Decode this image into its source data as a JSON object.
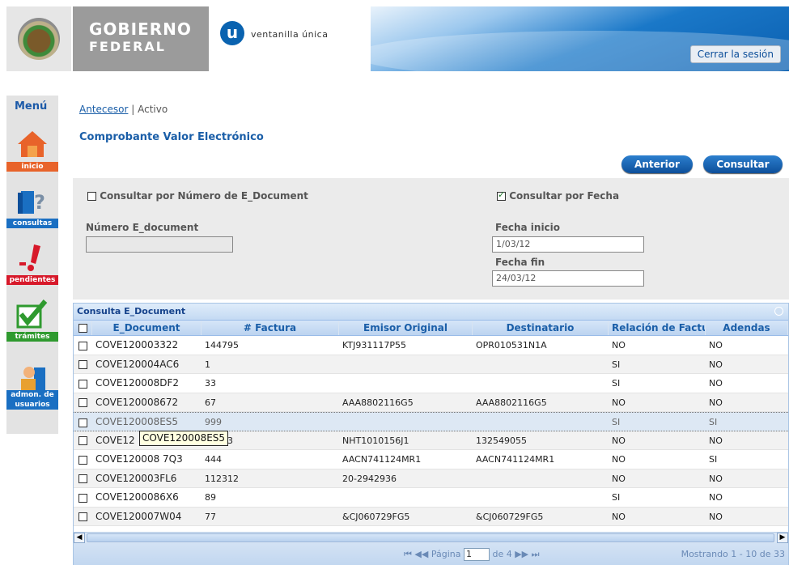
{
  "header": {
    "gov_title": "GOBIERNO",
    "gov_subtitle": "FEDERAL",
    "vu_letter": "u",
    "vu_text": "ventanilla única",
    "logout_label": "Cerrar la sesión"
  },
  "menu": {
    "title": "Menú",
    "items": [
      {
        "label": "inicio",
        "icon": "house-icon",
        "color": "#e8632a"
      },
      {
        "label": "consultas",
        "icon": "book-question-icon",
        "color": "#1a6fc2"
      },
      {
        "label": "pendientes",
        "icon": "exclamation-icon",
        "color": "#d7192a"
      },
      {
        "label": "trámites",
        "icon": "checkmark-icon",
        "color": "#2f9a2f"
      },
      {
        "label": "admon. de usuarios",
        "icon": "users-icon",
        "color": "#1a6fc2"
      }
    ]
  },
  "breadcrumb": {
    "link": "Antecesor",
    "separator": "|",
    "current": "Activo"
  },
  "page_title": "Comprobante Valor Electrónico",
  "buttons": {
    "previous": "Anterior",
    "query": "Consultar"
  },
  "search": {
    "by_number_label": "Consultar por Número de E_Document",
    "by_number_checked": false,
    "by_date_label": "Consultar por Fecha",
    "by_date_checked": true,
    "number_label": "Número E_document",
    "number_value": "",
    "start_label": "Fecha inicio",
    "start_value": "1/03/12",
    "end_label": "Fecha fin",
    "end_value": "24/03/12"
  },
  "grid": {
    "title": "Consulta E_Document",
    "columns": [
      "E_Document",
      "# Factura",
      "Emisor Original",
      "Destinatario",
      "Relación de Factur",
      "Adendas"
    ],
    "rows": [
      [
        "COVE120003322",
        "144795",
        "KTJ931117P55",
        "OPR010531N1A",
        "NO",
        "NO"
      ],
      [
        "COVE120004AC6",
        "1",
        "",
        "",
        "SI",
        "NO"
      ],
      [
        "COVE120008DF2",
        "33",
        "",
        "",
        "SI",
        "NO"
      ],
      [
        "COVE120008672",
        "67",
        "AAA8802116G5",
        "AAA8802116G5",
        "NO",
        "NO"
      ],
      [
        "COVE120008ES5",
        "999",
        "",
        "",
        "SI",
        "SI"
      ],
      [
        "COVE12",
        "61283",
        "NHT1010156J1",
        "132549055",
        "NO",
        "NO"
      ],
      [
        "COVE120008 7Q3",
        "444",
        "AACN741124MR1",
        "AACN741124MR1",
        "NO",
        "SI"
      ],
      [
        "COVE120003FL6",
        "112312",
        "20-2942936",
        "",
        "NO",
        "NO"
      ],
      [
        "COVE1200086X6",
        "89",
        "",
        "",
        "SI",
        "NO"
      ],
      [
        "COVE120007W04",
        "77",
        "&CJ060729FG5",
        "&CJ060729FG5",
        "NO",
        "NO"
      ]
    ],
    "tooltip": "COVE120008ES5",
    "pager": {
      "page_label": "Página",
      "page_value": "1",
      "of_label": "de 4",
      "info": "Mostrando 1 - 10 de 33"
    }
  }
}
